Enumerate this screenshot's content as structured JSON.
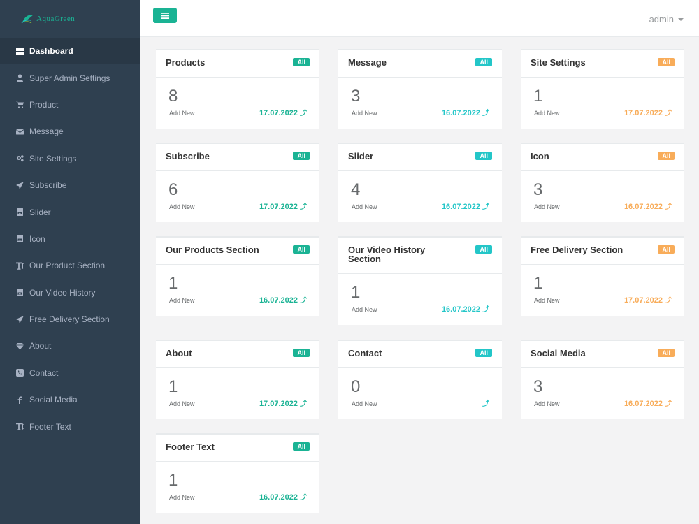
{
  "colors": {
    "green": "#1ab394",
    "teal": "#23c6c8",
    "orange": "#f8ac59",
    "sidebar": "#2f4050"
  },
  "logo": {
    "text": "AquaGreen"
  },
  "user": {
    "name": "admin"
  },
  "sidebar": {
    "items": [
      {
        "label": "Dashboard",
        "icon": "dashboard-icon"
      },
      {
        "label": "Super Admin Settings",
        "icon": "user-icon"
      },
      {
        "label": "Product",
        "icon": "cart-icon"
      },
      {
        "label": "Message",
        "icon": "envelope-icon"
      },
      {
        "label": "Site Settings",
        "icon": "gears-icon"
      },
      {
        "label": "Subscribe",
        "icon": "paper-plane-icon"
      },
      {
        "label": "Slider",
        "icon": "image-icon"
      },
      {
        "label": "Icon",
        "icon": "image-icon"
      },
      {
        "label": "Our Product Section",
        "icon": "text-height-icon"
      },
      {
        "label": "Our Video History",
        "icon": "image-icon"
      },
      {
        "label": "Free Delivery Section",
        "icon": "paper-plane-icon"
      },
      {
        "label": "About",
        "icon": "diamond-icon"
      },
      {
        "label": "Contact",
        "icon": "phone-icon"
      },
      {
        "label": "Social Media",
        "icon": "facebook-icon"
      },
      {
        "label": "Footer Text",
        "icon": "text-height-icon"
      }
    ]
  },
  "cards": [
    {
      "title": "Products",
      "badge": "All",
      "color": "green",
      "count": "8",
      "sub": "Add New",
      "date": "17.07.2022"
    },
    {
      "title": "Message",
      "badge": "All",
      "color": "teal",
      "count": "3",
      "sub": "Add New",
      "date": "16.07.2022"
    },
    {
      "title": "Site Settings",
      "badge": "All",
      "color": "orange",
      "count": "1",
      "sub": "Add New",
      "date": "17.07.2022"
    },
    {
      "title": "Subscribe",
      "badge": "All",
      "color": "green",
      "count": "6",
      "sub": "Add New",
      "date": "17.07.2022"
    },
    {
      "title": "Slider",
      "badge": "All",
      "color": "teal",
      "count": "4",
      "sub": "Add New",
      "date": "16.07.2022"
    },
    {
      "title": "Icon",
      "badge": "All",
      "color": "orange",
      "count": "3",
      "sub": "Add New",
      "date": "16.07.2022"
    },
    {
      "title": "Our Products Section",
      "badge": "All",
      "color": "green",
      "count": "1",
      "sub": "Add New",
      "date": "16.07.2022"
    },
    {
      "title": "Our Video History Section",
      "badge": "All",
      "color": "teal",
      "count": "1",
      "sub": "Add New",
      "date": "16.07.2022"
    },
    {
      "title": "Free Delivery Section",
      "badge": "All",
      "color": "orange",
      "count": "1",
      "sub": "Add New",
      "date": "17.07.2022"
    },
    {
      "title": "About",
      "badge": "All",
      "color": "green",
      "count": "1",
      "sub": "Add New",
      "date": "17.07.2022"
    },
    {
      "title": "Contact",
      "badge": "All",
      "color": "teal",
      "count": "0",
      "sub": "Add New",
      "date": ""
    },
    {
      "title": "Social Media",
      "badge": "All",
      "color": "orange",
      "count": "3",
      "sub": "Add New",
      "date": "16.07.2022"
    },
    {
      "title": "Footer Text",
      "badge": "All",
      "color": "green",
      "count": "1",
      "sub": "Add New",
      "date": "16.07.2022"
    }
  ]
}
